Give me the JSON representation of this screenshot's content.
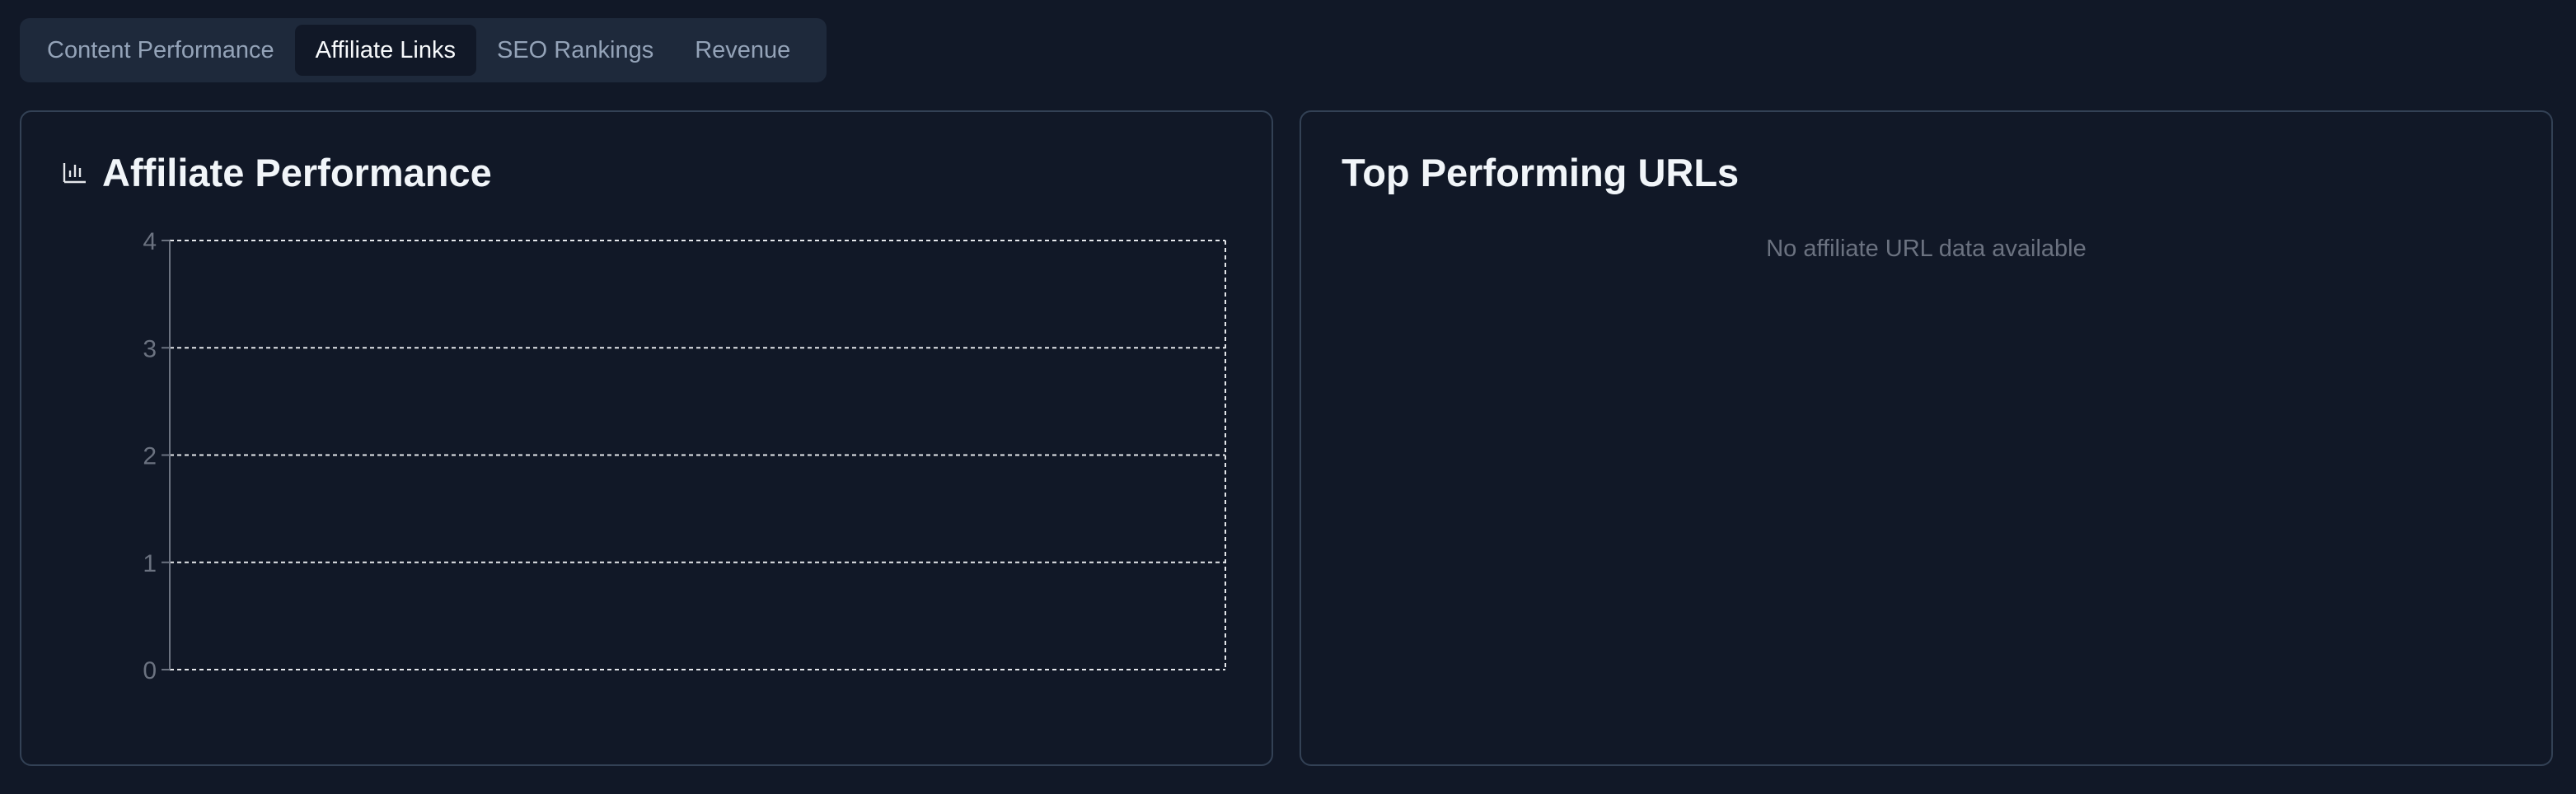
{
  "tabs": [
    {
      "label": "Content Performance",
      "active": false
    },
    {
      "label": "Affiliate Links",
      "active": true
    },
    {
      "label": "SEO Rankings",
      "active": false
    },
    {
      "label": "Revenue",
      "active": false
    }
  ],
  "affiliate_card": {
    "title": "Affiliate Performance",
    "icon": "bar-chart-icon"
  },
  "urls_card": {
    "title": "Top Performing URLs",
    "empty_message": "No affiliate URL data available"
  },
  "colors": {
    "background": "#111827",
    "tab_bar": "#1e293b",
    "card_border": "#334155",
    "muted_text": "#6b7280",
    "title_text": "#f1f5f9"
  },
  "chart_data": {
    "type": "bar",
    "categories": [],
    "values": [],
    "title": "",
    "xlabel": "",
    "ylabel": "",
    "ylim": [
      0,
      4
    ],
    "yticks": [
      0,
      1,
      2,
      3,
      4
    ],
    "grid": true
  }
}
